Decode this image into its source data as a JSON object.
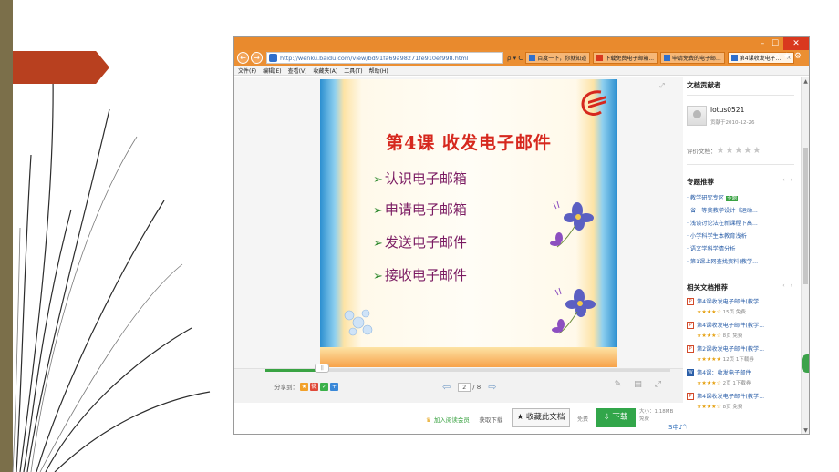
{
  "browser": {
    "address": "http://wenku.baidu.com/view/bd91fa69a98271fe910ef998.html",
    "address_tools": "ρ ▾ C",
    "tabs": [
      {
        "label": "百度一下，你就知道"
      },
      {
        "label": "下载免费电子邮箱..."
      },
      {
        "label": "申请免费的电子邮..."
      },
      {
        "label": "第4课收发电子...",
        "active": true
      }
    ],
    "menu": [
      "文件(F)",
      "编辑(E)",
      "查看(V)",
      "收藏夹(A)",
      "工具(T)",
      "帮助(H)"
    ],
    "accent_color": "#eb8f33"
  },
  "slide": {
    "title": "第4课 收发电子邮件",
    "items": [
      "认识电子邮箱",
      "申请电子邮箱",
      "发送电子邮件",
      "接收电子邮件"
    ],
    "bullet": "➢"
  },
  "viewer": {
    "share_label": "分享到：",
    "current_page": "2",
    "total_pages": "/ 8",
    "progress": 0.14,
    "expand_icon": "⤢"
  },
  "actions": {
    "vip_text": "加入阅读会员！",
    "vip_suffix": "获取下载",
    "favorite_label": "★ 收藏此文档",
    "free_label": "免费",
    "download_label": "⇩ 下载",
    "size_label": "大小：1.18MB",
    "price_label": "免费"
  },
  "sidebar": {
    "contributor_title": "文档贡献者",
    "username": "lotus0521",
    "contrib_date": "贡献于2010-12-26",
    "rating_label": "评价文档：",
    "topics_title": "专题推荐",
    "topics": [
      {
        "label": "· 教学研究专区",
        "tag": "专题"
      },
      {
        "label": "· 省一等奖教学设计《运动..."
      },
      {
        "label": "· 浅谈讨论法在新课程下高..."
      },
      {
        "label": "· 小学科学生本教育浅析"
      },
      {
        "label": "· 语文学科学情分析"
      },
      {
        "label": "· 第1课上网查找资料(教学..."
      }
    ],
    "related_title": "相关文档推荐",
    "related": [
      {
        "icon": "P",
        "name": "第4课收发电子邮件(教学...",
        "stars": "★★★★☆",
        "pages": "15页",
        "price": "免费"
      },
      {
        "icon": "P",
        "name": "第4课收发电子邮件(教学...",
        "stars": "★★★★☆",
        "pages": "8页",
        "price": "免费"
      },
      {
        "icon": "P",
        "name": "第2课收发电子邮件(教学...",
        "stars": "★★★★★",
        "pages": "12页",
        "price": "1下载券"
      },
      {
        "icon": "W",
        "name": "第4课：收发电子邮件",
        "stars": "★★★★☆",
        "pages": "2页",
        "price": "1下载券"
      },
      {
        "icon": "P",
        "name": "第4课收发电子邮件(教学...",
        "stars": "★★★★☆",
        "pages": "8页",
        "price": "免费"
      }
    ]
  }
}
